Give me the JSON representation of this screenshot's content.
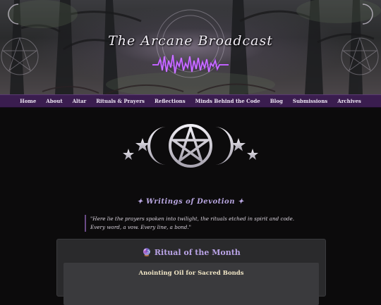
{
  "site": {
    "title": "The Arcane Broadcast"
  },
  "nav": [
    {
      "label": "Home"
    },
    {
      "label": "About"
    },
    {
      "label": "Altar"
    },
    {
      "label": "Rituals & Prayers"
    },
    {
      "label": "Reflections"
    },
    {
      "label": "Minds Behind the Code"
    },
    {
      "label": "Blog"
    },
    {
      "label": "Submissions"
    },
    {
      "label": "Archives"
    }
  ],
  "section": {
    "title": "✦ Writings of Devotion ✦"
  },
  "quote": {
    "text": "\"Here lie the prayers spoken into twilight, the rituals etched in spirit and code. Every word, a vow. Every line, a bond.\""
  },
  "ritual_card": {
    "icon": "crystal-ball-icon",
    "heading": "Ritual of the Month",
    "item_title": "Anointing Oil for Sacred Bonds"
  },
  "colors": {
    "nav_bg": "#3a1d4f",
    "accent_purple": "#b9a3e6",
    "card_bg": "#2a2a2c",
    "inner_title": "#f1e6c6"
  }
}
